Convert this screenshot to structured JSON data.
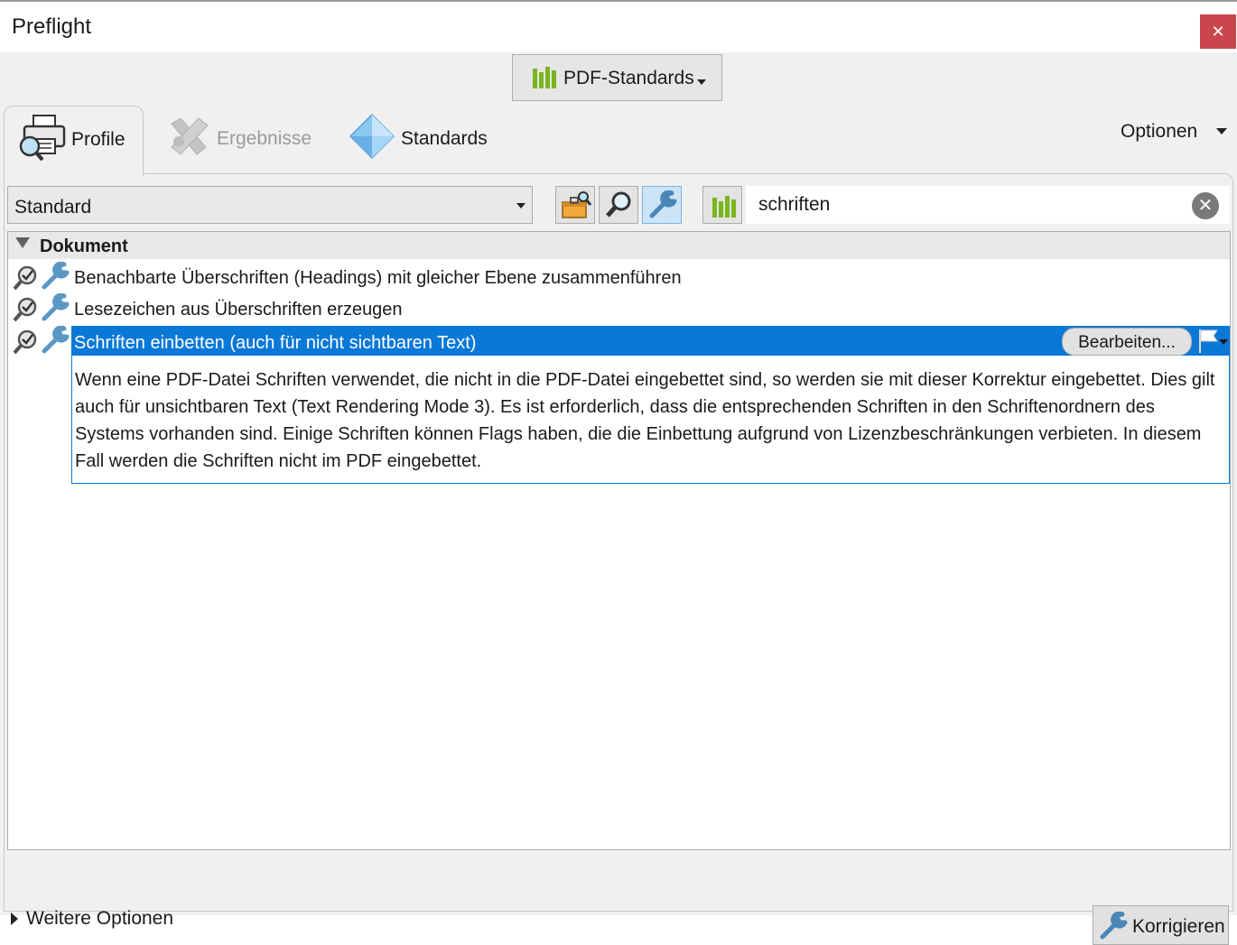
{
  "window": {
    "title": "Preflight",
    "close_icon": "close-icon",
    "close_glyph": "✕"
  },
  "toolbar": {
    "standards_button_label": "PDF-Standards"
  },
  "tabs": [
    {
      "label": "Profile",
      "icon": "printer-magnifier-icon",
      "state": "active"
    },
    {
      "label": "Ergebnisse",
      "icon": "results-cross-icon",
      "state": "disabled"
    },
    {
      "label": "Standards",
      "icon": "diamond-icon",
      "state": "normal"
    }
  ],
  "options_menu": {
    "label": "Optionen"
  },
  "profile_select": {
    "value": "Standard"
  },
  "search": {
    "value": "schriften"
  },
  "tree": {
    "group": {
      "label": "Dokument"
    },
    "items": [
      {
        "label": "Benachbarte Überschriften (Headings) mit gleicher Ebene zusammenführen",
        "selected": false
      },
      {
        "label": "Lesezeichen aus Überschriften erzeugen",
        "selected": false
      },
      {
        "label": "Schriften einbetten (auch für nicht sichtbaren Text)",
        "selected": true,
        "edit_button": "Bearbeiten..."
      }
    ],
    "description": "Wenn eine PDF-Datei Schriften verwendet, die nicht in die PDF-Datei eingebettet sind, so werden sie mit dieser Korrektur eingebettet. Dies gilt auch für unsichtbaren Text (Text Rendering Mode 3). Es ist erforderlich, dass die entsprechenden Schriften in den Schriftenordnern des Systems vorhanden sind. Einige Schriften können Flags haben, die die Einbettung aufgrund von Lizenzbeschränkungen verbieten. In diesem Fall werden die Schriften nicht im PDF eingebettet."
  },
  "footer": {
    "more_options": "Weitere Optionen",
    "fix_button": "Korrigieren"
  },
  "colors": {
    "accent": "#0a78d7",
    "close": "#c9464c",
    "bars": "#7ab51d",
    "wrench": "#4a86b8"
  }
}
